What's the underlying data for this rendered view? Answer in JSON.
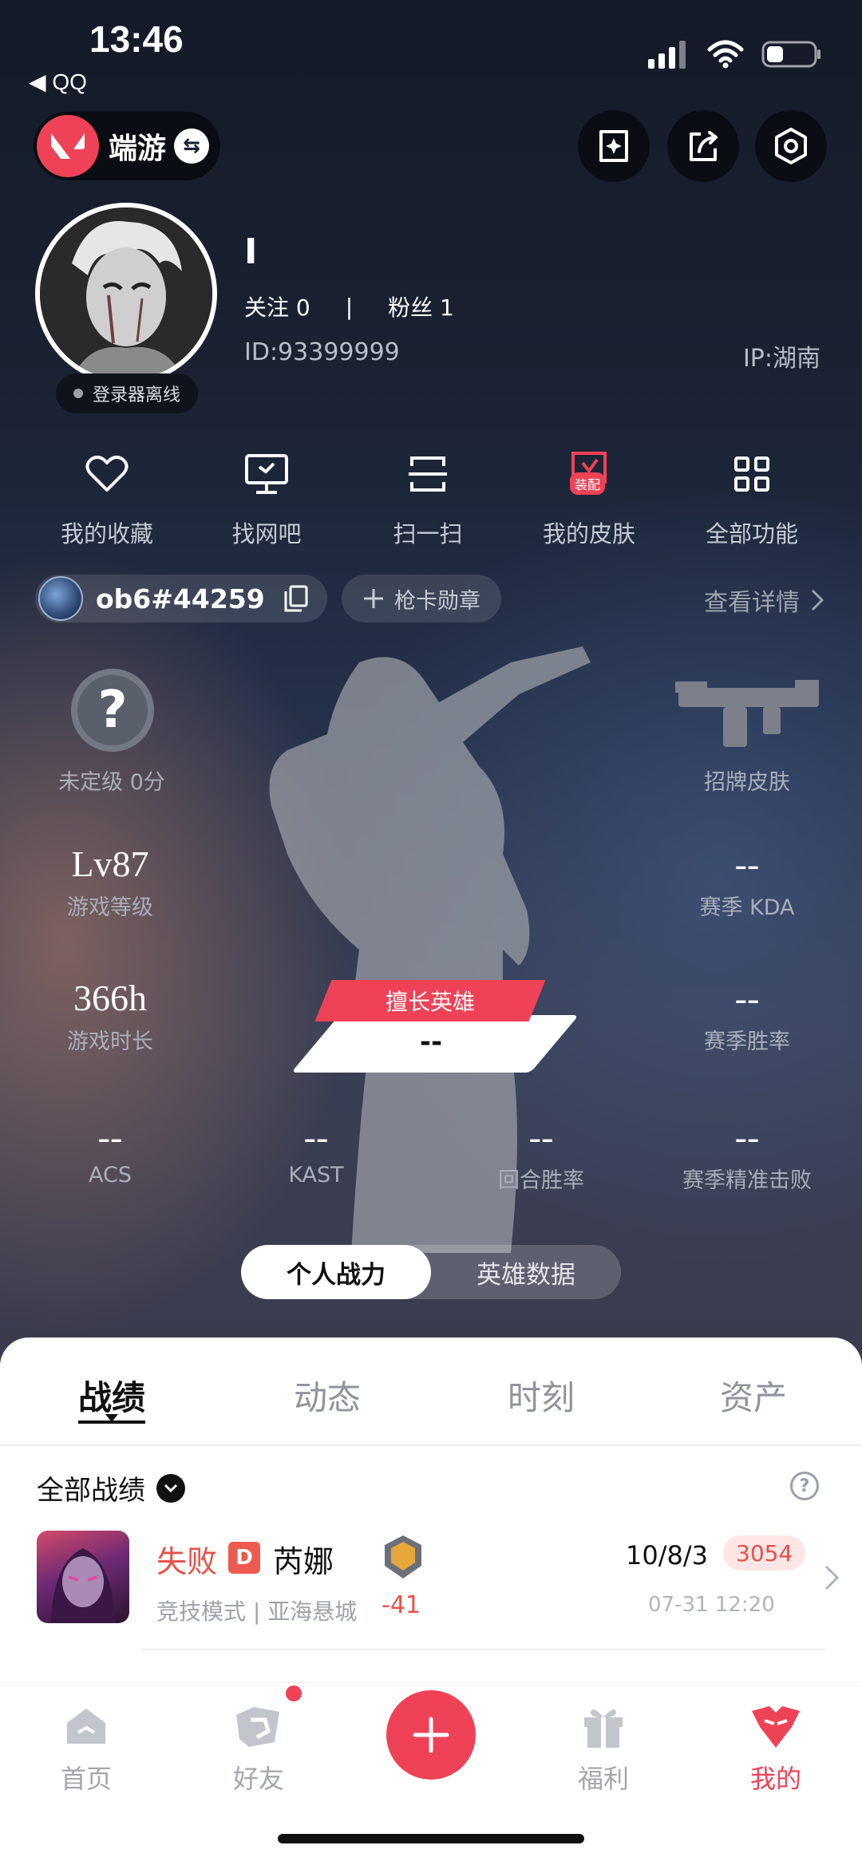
{
  "status_bar": {
    "time": "13:46",
    "back_app": "◀ QQ",
    "battery_level": 0.35
  },
  "header": {
    "mode_label": "端游",
    "swap_icon": "swap-icon",
    "actions": [
      "card-edit-icon",
      "share-icon",
      "settings-icon"
    ]
  },
  "profile": {
    "nickname": "I",
    "follow_label": "关注 0",
    "fans_label": "粉丝 1",
    "separator": "|",
    "id_text": "ID:93399999",
    "ip_text": "IP:湖南",
    "login_status": "登录器离线"
  },
  "quick_actions": [
    {
      "label": "我的收藏",
      "icon": "heart-icon"
    },
    {
      "label": "找网吧",
      "icon": "monitor-icon"
    },
    {
      "label": "扫一扫",
      "icon": "scan-icon"
    },
    {
      "label": "我的皮肤",
      "icon": "skin-icon",
      "badge": "装配"
    },
    {
      "label": "全部功能",
      "icon": "grid-icon"
    }
  ],
  "account": {
    "riot_id": "ob6#44259",
    "badge_label": "枪卡勋章",
    "detail_label": "查看详情"
  },
  "stats": {
    "rank_label": "未定级 0分",
    "rank_icon": "?",
    "skin_label": "招牌皮肤",
    "level_value": "Lv87",
    "level_label": "游戏等级",
    "kda_value": "--",
    "kda_label": "赛季 KDA",
    "hours_value": "366h",
    "hours_label": "游戏时长",
    "winrate_value": "--",
    "winrate_label": "赛季胜率",
    "hero_tag": "擅长英雄",
    "hero_value": "--",
    "bottom": [
      {
        "value": "--",
        "label": "ACS"
      },
      {
        "value": "--",
        "label": "KAST"
      },
      {
        "value": "--",
        "label": "回合胜率"
      },
      {
        "value": "--",
        "label": "赛季精准击败"
      }
    ]
  },
  "segment": {
    "active": "个人战力",
    "inactive": "英雄数据"
  },
  "tabs": [
    {
      "label": "战绩",
      "active": true
    },
    {
      "label": "动态",
      "active": false
    },
    {
      "label": "时刻",
      "active": false
    },
    {
      "label": "资产",
      "active": false
    }
  ],
  "record_filter": {
    "label": "全部战绩",
    "help": "?"
  },
  "matches": [
    {
      "result": "失败",
      "grade": "D",
      "agent": "芮娜",
      "mode": "竞技模式 | 亚海悬城",
      "rank_delta": "-41",
      "kda": "10/8/3",
      "score": "3054",
      "time": "07-31 12:20"
    }
  ],
  "bottom_nav": [
    {
      "label": "首页",
      "icon": "home-icon",
      "active": false
    },
    {
      "label": "好友",
      "icon": "friends-icon",
      "active": false,
      "dot": true
    },
    {
      "label": "",
      "icon": "plus-icon",
      "active": false
    },
    {
      "label": "福利",
      "icon": "gift-icon",
      "active": false
    },
    {
      "label": "我的",
      "icon": "me-icon",
      "active": true
    }
  ],
  "colors": {
    "accent": "#f04257",
    "loss": "#e8504a",
    "sheet_bg": "#ffffff",
    "page_bg": "#1a2133"
  }
}
